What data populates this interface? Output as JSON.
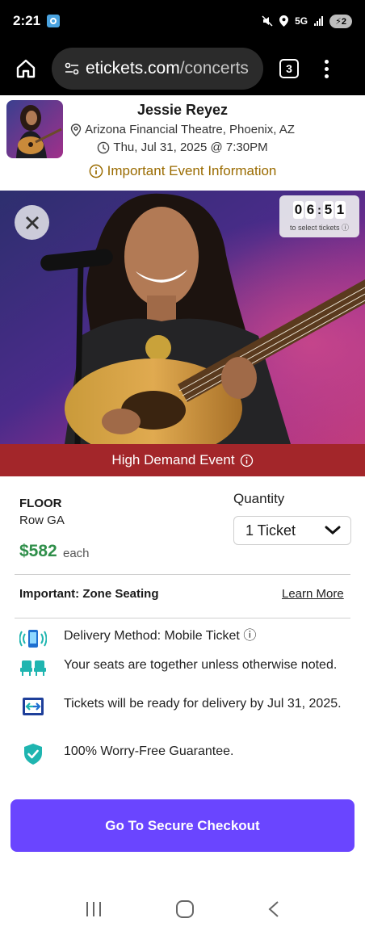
{
  "status_bar": {
    "time": "2:21",
    "network": "5G",
    "battery": "2"
  },
  "browser": {
    "url_host": "etickets.com",
    "url_path": "/concerts",
    "tab_count": "3"
  },
  "event": {
    "artist": "Jessie Reyez",
    "venue": "Arizona Financial Theatre, Phoenix, AZ",
    "datetime": "Thu, Jul 31, 2025 @ 7:30PM",
    "important_info": "Important Event Information"
  },
  "timer": {
    "digits": [
      "0",
      "6",
      "5",
      "1"
    ],
    "label": "to select tickets"
  },
  "demand_banner": "High Demand Event",
  "ticket": {
    "zone": "FLOOR",
    "row": "Row GA",
    "price": "$582",
    "price_unit": "each",
    "quantity_label": "Quantity",
    "quantity_value": "1 Ticket"
  },
  "zone_notice": {
    "title": "Important: Zone Seating",
    "link": "Learn More"
  },
  "features": [
    {
      "icon": "mobile-ticket-icon",
      "text": "Delivery Method: Mobile Ticket"
    },
    {
      "icon": "seats-together-icon",
      "text": "Your seats are together unless otherwise noted."
    },
    {
      "icon": "ticket-delivery-icon",
      "text": "Tickets will be ready for delivery by Jul 31, 2025."
    },
    {
      "icon": "guarantee-shield-icon",
      "text": "100% Worry-Free Guarantee."
    }
  ],
  "checkout_label": "Go To Secure Checkout",
  "colors": {
    "accent": "#6a45ff",
    "banner": "#a3262a",
    "price": "#2f8f4a",
    "info": "#9a6b00",
    "teal": "#1fb5b0"
  }
}
